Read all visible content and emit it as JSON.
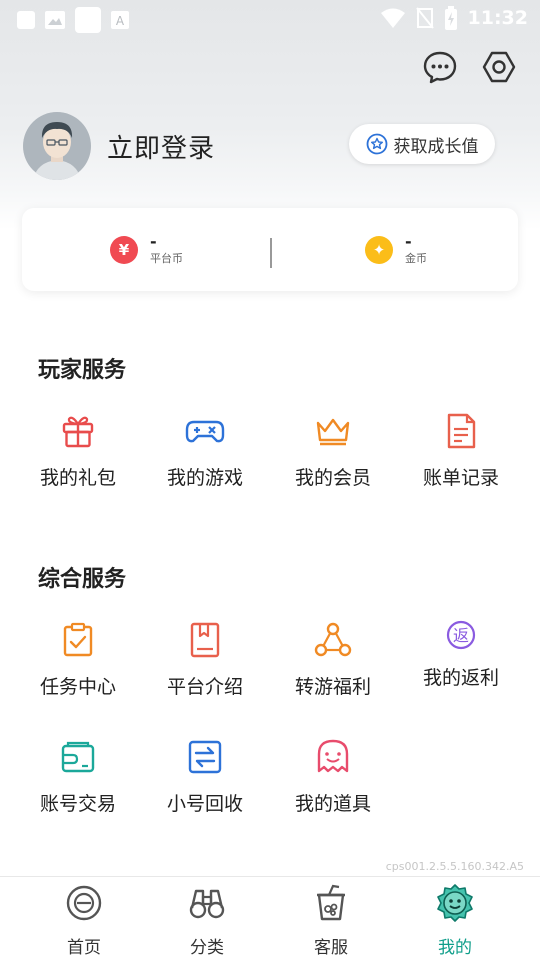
{
  "status_bar": {
    "time": "11:32"
  },
  "header": {
    "chat_icon": "chat-bubble-icon",
    "settings_icon": "hexagon-gear-icon"
  },
  "profile": {
    "login_label": "立即登录",
    "growth_button": "获取成长值"
  },
  "wallet": {
    "platform": {
      "symbol": "¥",
      "value": "-",
      "label": "平台币",
      "color": "#f04a52"
    },
    "gold": {
      "symbol": "✦",
      "value": "-",
      "label": "金币",
      "color": "#fbbd19"
    }
  },
  "player_services": {
    "title": "玩家服务",
    "items": [
      {
        "label": "我的礼包",
        "icon": "gift-icon"
      },
      {
        "label": "我的游戏",
        "icon": "gamepad-icon"
      },
      {
        "label": "我的会员",
        "icon": "crown-icon"
      },
      {
        "label": "账单记录",
        "icon": "bill-icon"
      }
    ]
  },
  "general_services": {
    "title": "综合服务",
    "items": [
      {
        "label": "任务中心",
        "icon": "clipboard-check-icon"
      },
      {
        "label": "平台介绍",
        "icon": "book-icon"
      },
      {
        "label": "转游福利",
        "icon": "share-nodes-icon"
      },
      {
        "label": "我的返利",
        "icon": "rebate-icon",
        "glyph": "返"
      },
      {
        "label": "账号交易",
        "icon": "wallet-icon"
      },
      {
        "label": "小号回收",
        "icon": "exchange-icon"
      },
      {
        "label": "我的道具",
        "icon": "ghost-icon"
      }
    ]
  },
  "version": "cps001.2.5.5.160.342.A5",
  "tabs": [
    {
      "label": "首页",
      "icon": "home-circle-icon"
    },
    {
      "label": "分类",
      "icon": "binoculars-icon"
    },
    {
      "label": "客服",
      "icon": "cup-icon"
    },
    {
      "label": "我的",
      "icon": "smiley-badge-icon",
      "active": true
    }
  ],
  "colors": {
    "accent": "#0f9e8a",
    "orange": "#f08a24",
    "red": "#e84c4c",
    "blue": "#2d72d8",
    "purple": "#8a5be0",
    "teal": "#1ba89a"
  }
}
